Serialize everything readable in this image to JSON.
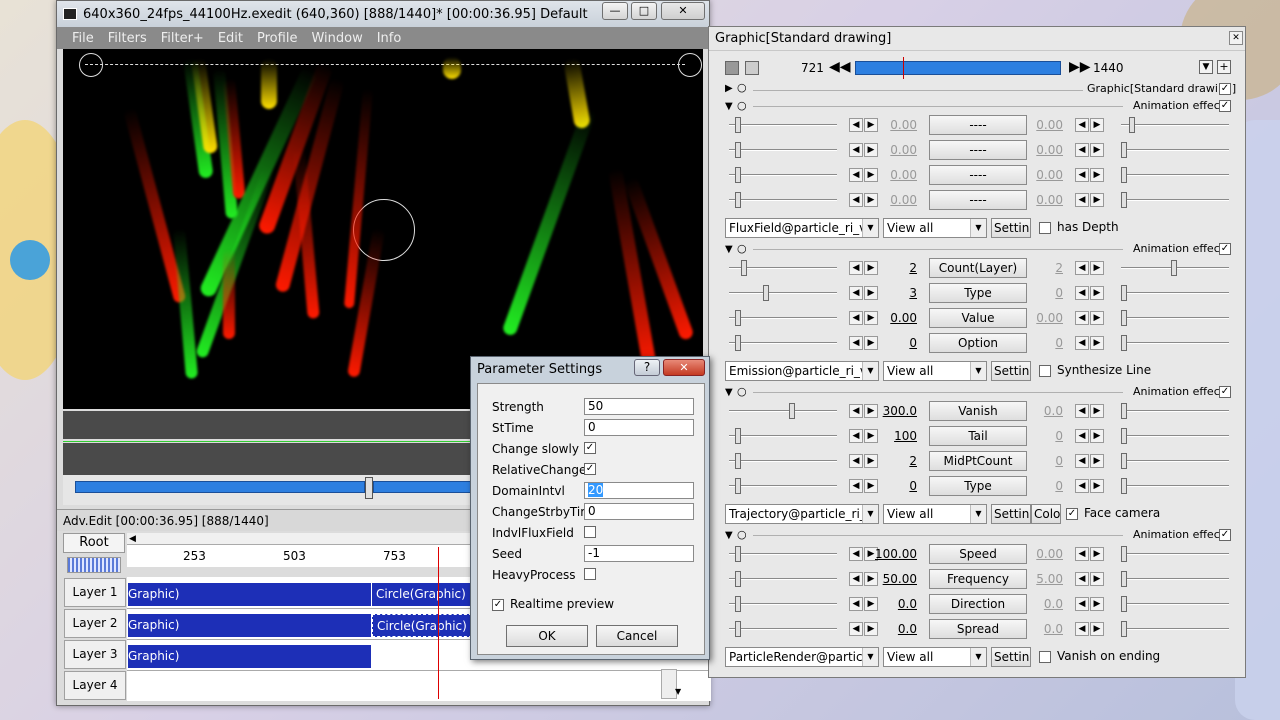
{
  "main_window": {
    "title": "640x360_24fps_44100Hz.exedit (640,360)  [888/1440]* [00:00:36.95]  Default",
    "menu": [
      "File",
      "Filters",
      "Filter+",
      "Edit",
      "Profile",
      "Window",
      "Info"
    ]
  },
  "timeline": {
    "title": "Adv.Edit [00:00:36.95] [888/1440]",
    "root_label": "Root",
    "ruler": [
      "253",
      "503",
      "753"
    ],
    "layers": [
      "Layer 1",
      "Layer 2",
      "Layer 3",
      "Layer 4"
    ],
    "clips": [
      {
        "left": "Graphic)",
        "right": "Circle(Graphic)"
      },
      {
        "left": "Graphic)",
        "right": "Circle(Graphic)"
      },
      {
        "left": "Graphic)",
        "right": ""
      }
    ]
  },
  "panel": {
    "title": "Graphic[Standard drawing]",
    "frame_start": "721",
    "frame_end": "1440",
    "object_label": "Graphic[Standard drawing]",
    "anim_label": "Animation effect",
    "sections": [
      {
        "rows": [
          {
            "left": "0.00",
            "btn": "----",
            "right": "0.00"
          },
          {
            "left": "0.00",
            "btn": "----",
            "right": "0.00"
          },
          {
            "left": "0.00",
            "btn": "----",
            "right": "0.00"
          },
          {
            "left": "0.00",
            "btn": "----",
            "right": "0.00"
          }
        ],
        "script": "FluxField@particle_ri_ve",
        "view": "View all",
        "setting": "Setting",
        "extra_check": "has Depth",
        "extra_checked": false
      },
      {
        "rows": [
          {
            "left": "2",
            "btn": "Count(Layer)",
            "right": "2"
          },
          {
            "left": "3",
            "btn": "Type",
            "right": "0"
          },
          {
            "left": "0.00",
            "btn": "Value",
            "right": "0.00"
          },
          {
            "left": "0",
            "btn": "Option",
            "right": "0"
          }
        ],
        "script": "Emission@particle_ri_ve",
        "view": "View all",
        "setting": "Setting",
        "extra_check": "Synthesize Line",
        "extra_checked": false
      },
      {
        "rows": [
          {
            "left": "300.0",
            "btn": "Vanish",
            "right": "0.0"
          },
          {
            "left": "100",
            "btn": "Tail",
            "right": "0"
          },
          {
            "left": "2",
            "btn": "MidPtCount",
            "right": "0"
          },
          {
            "left": "0",
            "btn": "Type",
            "right": "0"
          }
        ],
        "script": "Trajectory@particle_ri_ve",
        "view": "View all",
        "setting": "Setting",
        "color_btn": "Colo",
        "extra_check": "Face camera",
        "extra_checked": true
      },
      {
        "rows": [
          {
            "left": "100.00",
            "btn": "Speed",
            "right": "0.00"
          },
          {
            "left": "50.00",
            "btn": "Frequency",
            "right": "5.00"
          },
          {
            "left": "0.0",
            "btn": "Direction",
            "right": "0.0"
          },
          {
            "left": "0.0",
            "btn": "Spread",
            "right": "0.0"
          }
        ],
        "script": "ParticleRender@particle",
        "view": "View all",
        "setting": "Setting",
        "extra_check": "Vanish on ending",
        "extra_checked": false
      }
    ]
  },
  "dialog": {
    "title": "Parameter Settings",
    "help": "?",
    "close": "✕",
    "fields": [
      {
        "label": "Strength",
        "type": "text",
        "value": "50"
      },
      {
        "label": "StTime",
        "type": "text",
        "value": "0"
      },
      {
        "label": "Change slowly",
        "type": "check",
        "value": "✓"
      },
      {
        "label": "RelativeChange",
        "type": "check",
        "value": "✓"
      },
      {
        "label": "DomainIntvl",
        "type": "text",
        "value": "20"
      },
      {
        "label": "ChangeStrbyTime",
        "type": "text",
        "value": "0"
      },
      {
        "label": "IndvlFluxField",
        "type": "check",
        "value": ""
      },
      {
        "label": "Seed",
        "type": "text",
        "value": "-1"
      },
      {
        "label": "HeavyProcess",
        "type": "check",
        "value": ""
      }
    ],
    "realtime": "Realtime preview",
    "ok": "OK",
    "cancel": "Cancel"
  },
  "colors": {
    "clip": "#1d2fb7",
    "slider": "#2d7fe0",
    "particle_red": "#ff1a00",
    "particle_green": "#22ee22",
    "particle_yellow": "#ffe000"
  }
}
